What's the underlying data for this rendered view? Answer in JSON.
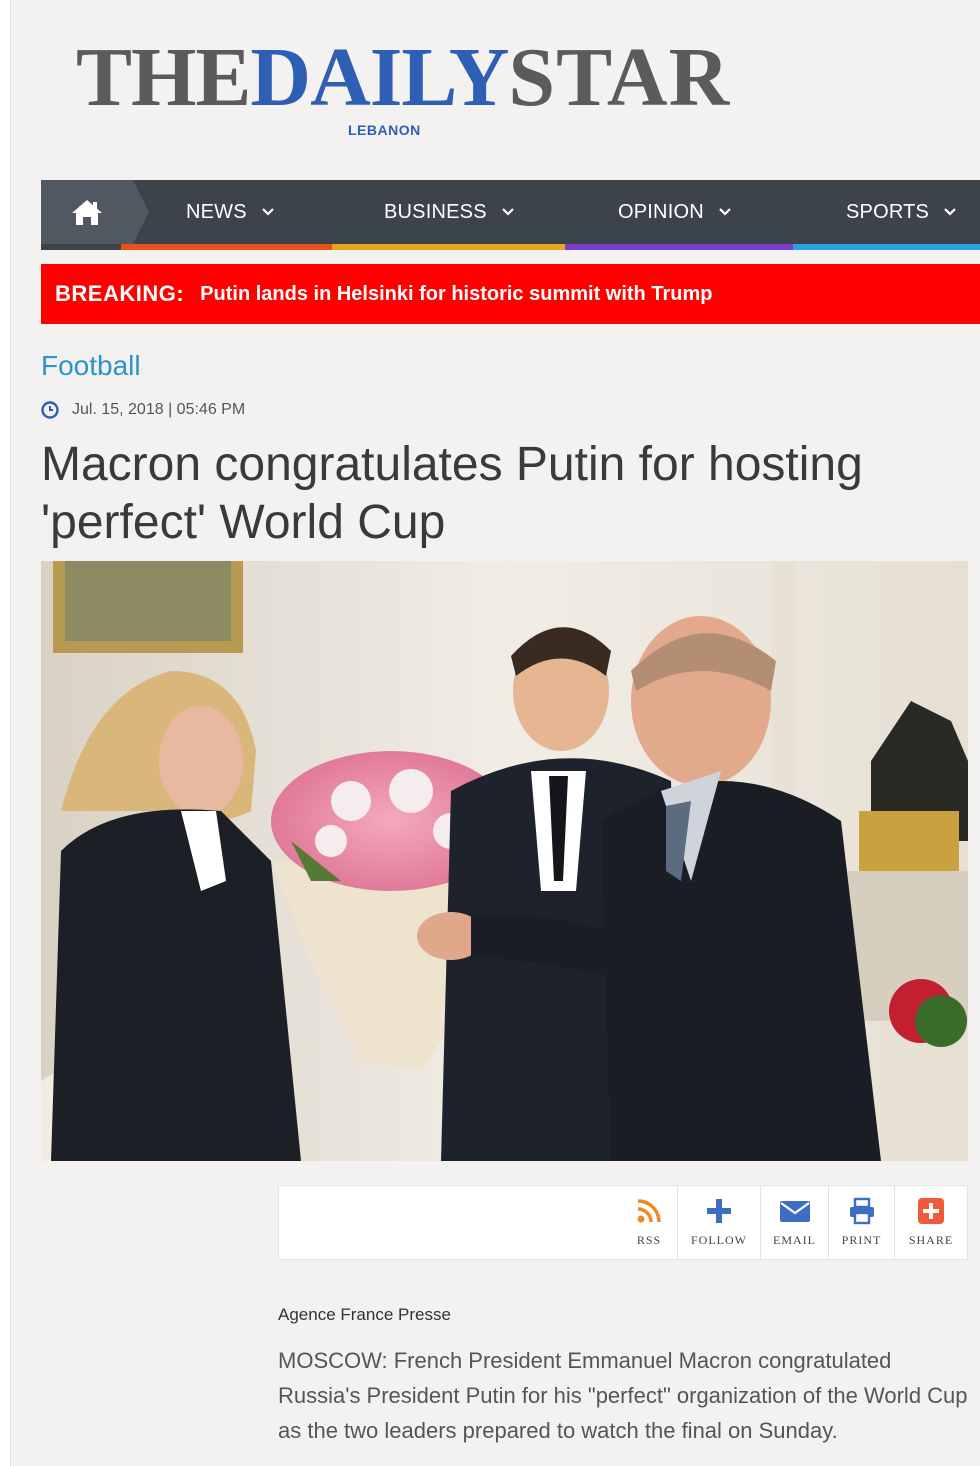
{
  "masthead": {
    "logo_the": "THE",
    "logo_daily": "DAILY",
    "logo_star": "STAR",
    "logo_sub": "LEBANON",
    "brand_color": "#2f5fb5"
  },
  "nav": {
    "home_icon": "home-icon",
    "items": [
      {
        "label": "NEWS",
        "stripe": "#e8511c"
      },
      {
        "label": "BUSINESS",
        "stripe": "#e5a61c"
      },
      {
        "label": "OPINION",
        "stripe": "#7b3fce"
      },
      {
        "label": "SPORTS",
        "stripe": "#2aa3e0"
      }
    ]
  },
  "breaking": {
    "label": "BREAKING:",
    "text": "Putin lands in Helsinki for historic summit with Trump",
    "color": "#ff0000"
  },
  "article": {
    "section": "Football",
    "date": "Jul. 15, 2018 | 05:46 PM",
    "headline": "Macron congratulates Putin for hosting 'perfect' World Cup",
    "byline": "Agence France Presse",
    "lede": "MOSCOW: French President Emmanuel Macron congratulated Russia's President Putin for his \"perfect\" organization of the World Cup as the two leaders prepared to watch the final on Sunday."
  },
  "toolbar": {
    "rss": "RSS",
    "follow": "FOLLOW",
    "email": "EMAIL",
    "print": "PRINT",
    "share": "SHARE"
  }
}
